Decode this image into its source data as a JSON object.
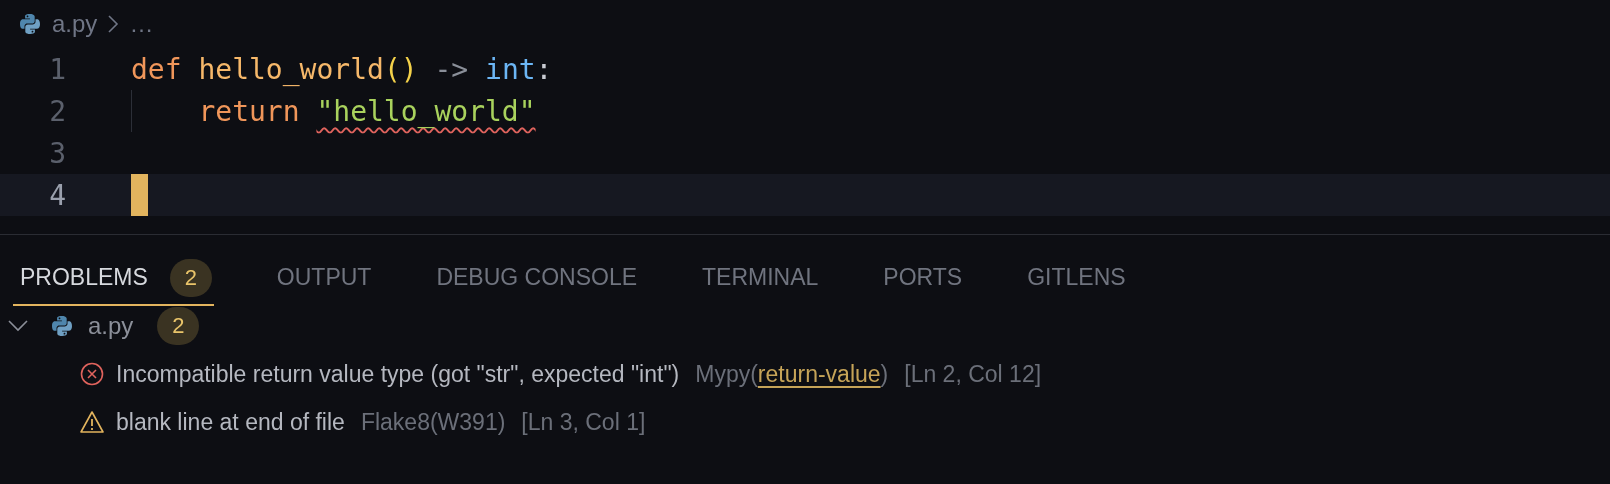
{
  "breadcrumb": {
    "file": "a.py",
    "more": "…"
  },
  "editor": {
    "lines": [
      {
        "number": "1",
        "current": false,
        "indent_guide": false,
        "cursor": false,
        "tokens": [
          {
            "text": "def ",
            "kind": "keyword"
          },
          {
            "text": "hello_world",
            "kind": "function"
          },
          {
            "text": "()",
            "kind": "bracket"
          },
          {
            "text": " ->",
            "kind": "operator"
          },
          {
            "text": " int",
            "kind": "type"
          },
          {
            "text": ":",
            "kind": "plain"
          }
        ]
      },
      {
        "number": "2",
        "current": false,
        "indent_guide": true,
        "cursor": false,
        "tokens": [
          {
            "text": "    return ",
            "kind": "keyword"
          },
          {
            "text": "\"hello_world\"",
            "kind": "string",
            "error": true
          }
        ]
      },
      {
        "number": "3",
        "current": false,
        "indent_guide": false,
        "cursor": false
      },
      {
        "number": "4",
        "current": true,
        "indent_guide": false,
        "cursor": true
      }
    ]
  },
  "panel": {
    "tabs": [
      {
        "label": "PROBLEMS",
        "selected": true,
        "badge": "2"
      },
      {
        "label": "OUTPUT",
        "selected": false
      },
      {
        "label": "DEBUG CONSOLE",
        "selected": false
      },
      {
        "label": "TERMINAL",
        "selected": false
      },
      {
        "label": "PORTS",
        "selected": false
      },
      {
        "label": "GITLENS",
        "selected": false
      }
    ],
    "file": {
      "name": "a.py",
      "count": "2",
      "expanded": true,
      "problems": [
        {
          "kind": "error",
          "message": "Incompatible return value type (got \"str\", expected \"int\")",
          "source": [
            {
              "text": "Mypy(",
              "kind": "plain"
            },
            {
              "text": "return-value",
              "kind": "link"
            },
            {
              "text": ")",
              "kind": "plain"
            }
          ],
          "location": "[Ln 2, Col 12]"
        },
        {
          "kind": "warning",
          "message": "blank line at end of file",
          "source": [
            {
              "text": "Flake8(W391)",
              "kind": "plain"
            }
          ],
          "location": "[Ln 3, Col 1]"
        }
      ]
    }
  }
}
